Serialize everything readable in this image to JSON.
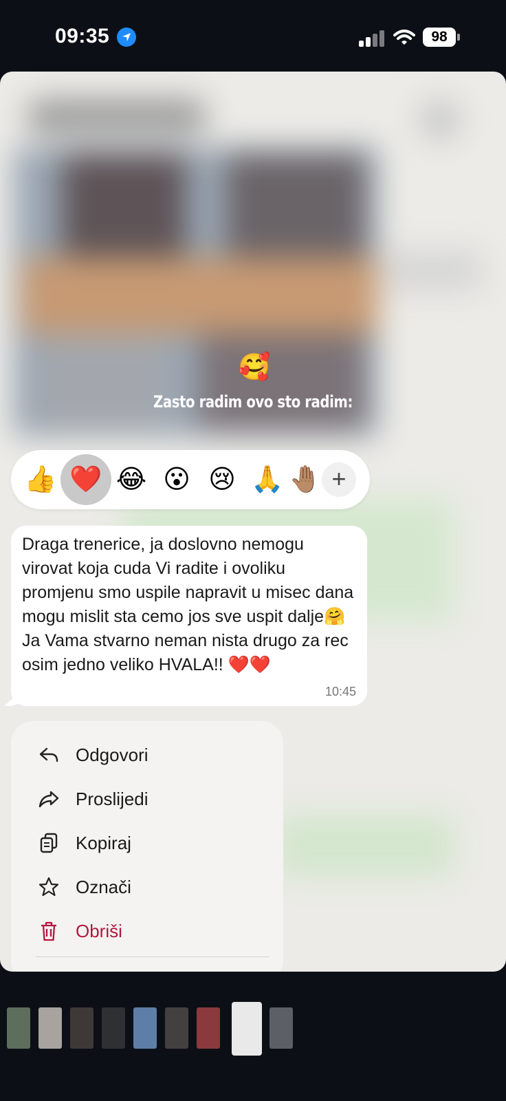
{
  "status_bar": {
    "time": "09:35",
    "battery": "98"
  },
  "story": {
    "emoji": "🥰",
    "caption": "Zasto radim ovo sto radim:"
  },
  "reactions": {
    "items": [
      "👍",
      "❤️",
      "😂",
      "😮",
      "😢",
      "🙏",
      "🤚🏽"
    ],
    "selected_index": 1,
    "more_label": "+"
  },
  "message": {
    "text": "Draga trenerice, ja doslovno nemogu virovat koja cuda Vi radite i ovoliku promjenu smo uspile napravit u misec dana mogu mislit sta cemo jos sve uspit dalje🤗Ja Vama stvarno neman nista drugo za rec osim jedno veliko HVALA!! ❤️❤️",
    "time": "10:45"
  },
  "menu": {
    "items": [
      {
        "label": "Odgovori",
        "icon": "reply-icon"
      },
      {
        "label": "Proslijedi",
        "icon": "forward-icon"
      },
      {
        "label": "Kopiraj",
        "icon": "copy-icon"
      },
      {
        "label": "Označi",
        "icon": "star-icon"
      },
      {
        "label": "Obriši",
        "icon": "trash-icon"
      }
    ]
  },
  "thumbnails": {
    "count": 9,
    "active_index": 7
  },
  "colors": {
    "accent": "#1e8cff",
    "danger": "#b3163e",
    "card": "#ecebe7",
    "background": "#0c1016"
  }
}
